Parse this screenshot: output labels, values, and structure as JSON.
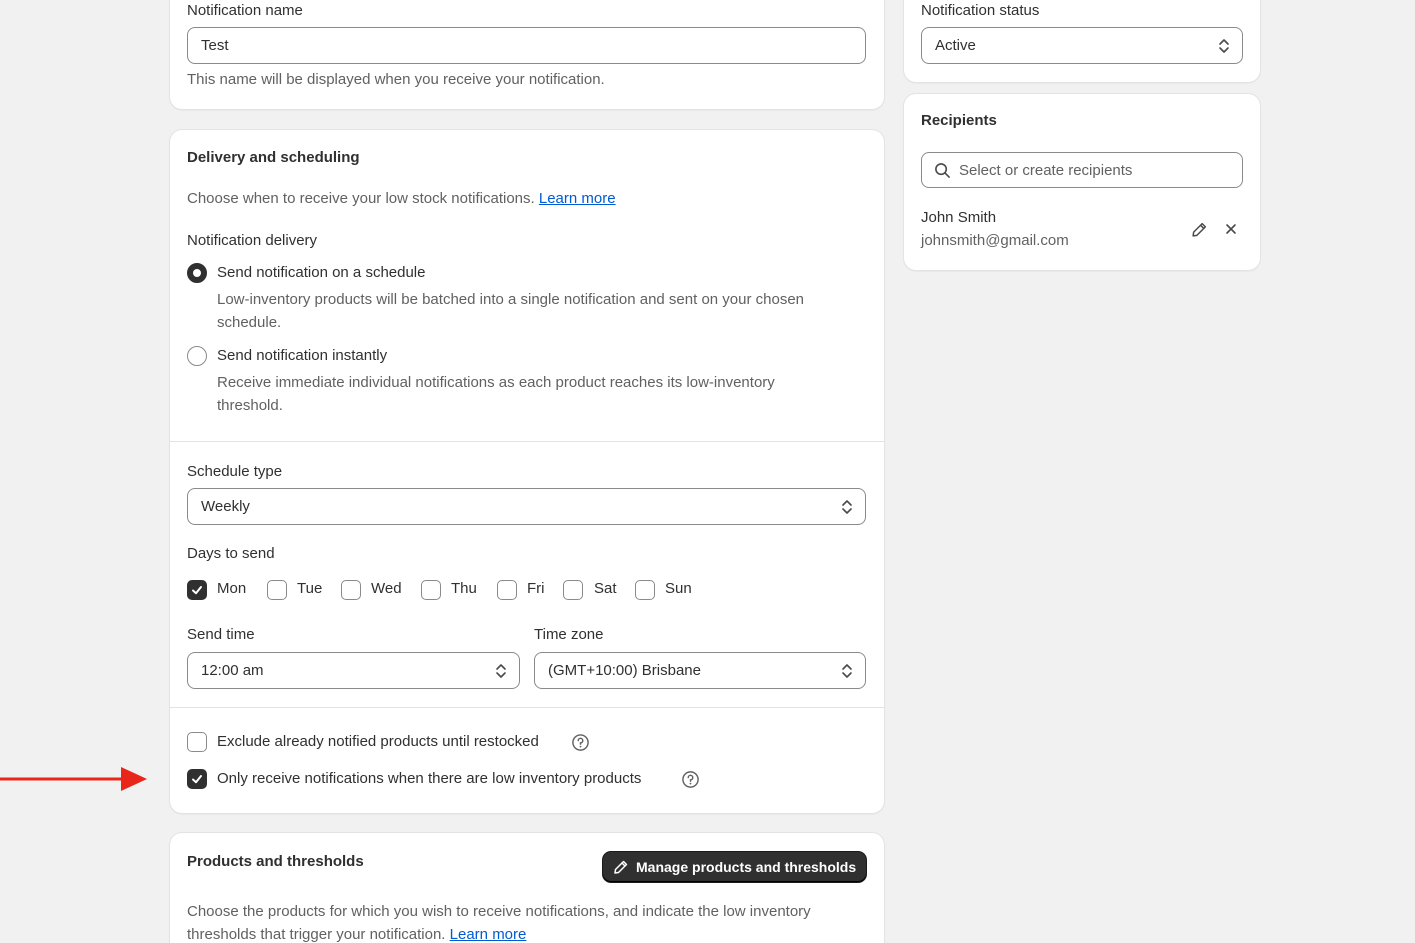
{
  "notification_name": {
    "label": "Notification name",
    "value": "Test",
    "help": "This name will be displayed when you receive your notification."
  },
  "delivery": {
    "heading": "Delivery and scheduling",
    "intro": "Choose when to receive your low stock notifications.",
    "learn_more": "Learn more",
    "delivery_label": "Notification delivery",
    "options": [
      {
        "label": "Send notification on a schedule",
        "desc_line1": "Low-inventory products will be batched into a single notification and sent on your chosen",
        "desc_line2": "schedule.",
        "selected": true
      },
      {
        "label": "Send notification instantly",
        "desc_line1": "Receive immediate individual notifications as each product reaches its low-inventory",
        "desc_line2": "threshold.",
        "selected": false
      }
    ],
    "schedule_type_label": "Schedule type",
    "schedule_type_value": "Weekly",
    "days_label": "Days to send",
    "days": [
      {
        "label": "Mon",
        "checked": true
      },
      {
        "label": "Tue",
        "checked": false
      },
      {
        "label": "Wed",
        "checked": false
      },
      {
        "label": "Thu",
        "checked": false
      },
      {
        "label": "Fri",
        "checked": false
      },
      {
        "label": "Sat",
        "checked": false
      },
      {
        "label": "Sun",
        "checked": false
      }
    ],
    "send_time_label": "Send time",
    "send_time_value": "12:00 am",
    "time_zone_label": "Time zone",
    "time_zone_value": "(GMT+10:00) Brisbane",
    "exclude_label": "Exclude already notified products until restocked",
    "exclude_checked": false,
    "only_low_label": "Only receive notifications when there are low inventory products",
    "only_low_checked": true
  },
  "products": {
    "heading": "Products and thresholds",
    "manage_button": "Manage products and thresholds",
    "desc_line1": "Choose the products for which you wish to receive notifications, and indicate the low inventory",
    "desc_line2": "thresholds that trigger your notification.",
    "learn_more": "Learn more"
  },
  "status": {
    "label": "Notification status",
    "value": "Active"
  },
  "recipients": {
    "heading": "Recipients",
    "search_placeholder": "Select or create recipients",
    "list": [
      {
        "name": "John Smith",
        "email": "johnsmith@gmail.com"
      }
    ]
  },
  "colors": {
    "annotation_arrow": "#e8261a",
    "link": "#005bd3",
    "primary_button": "#303030"
  },
  "icons": {
    "help": "question-circle-icon",
    "edit": "pencil-icon",
    "remove": "close-icon",
    "search": "search-icon",
    "select": "chevron-up-down-icon"
  }
}
